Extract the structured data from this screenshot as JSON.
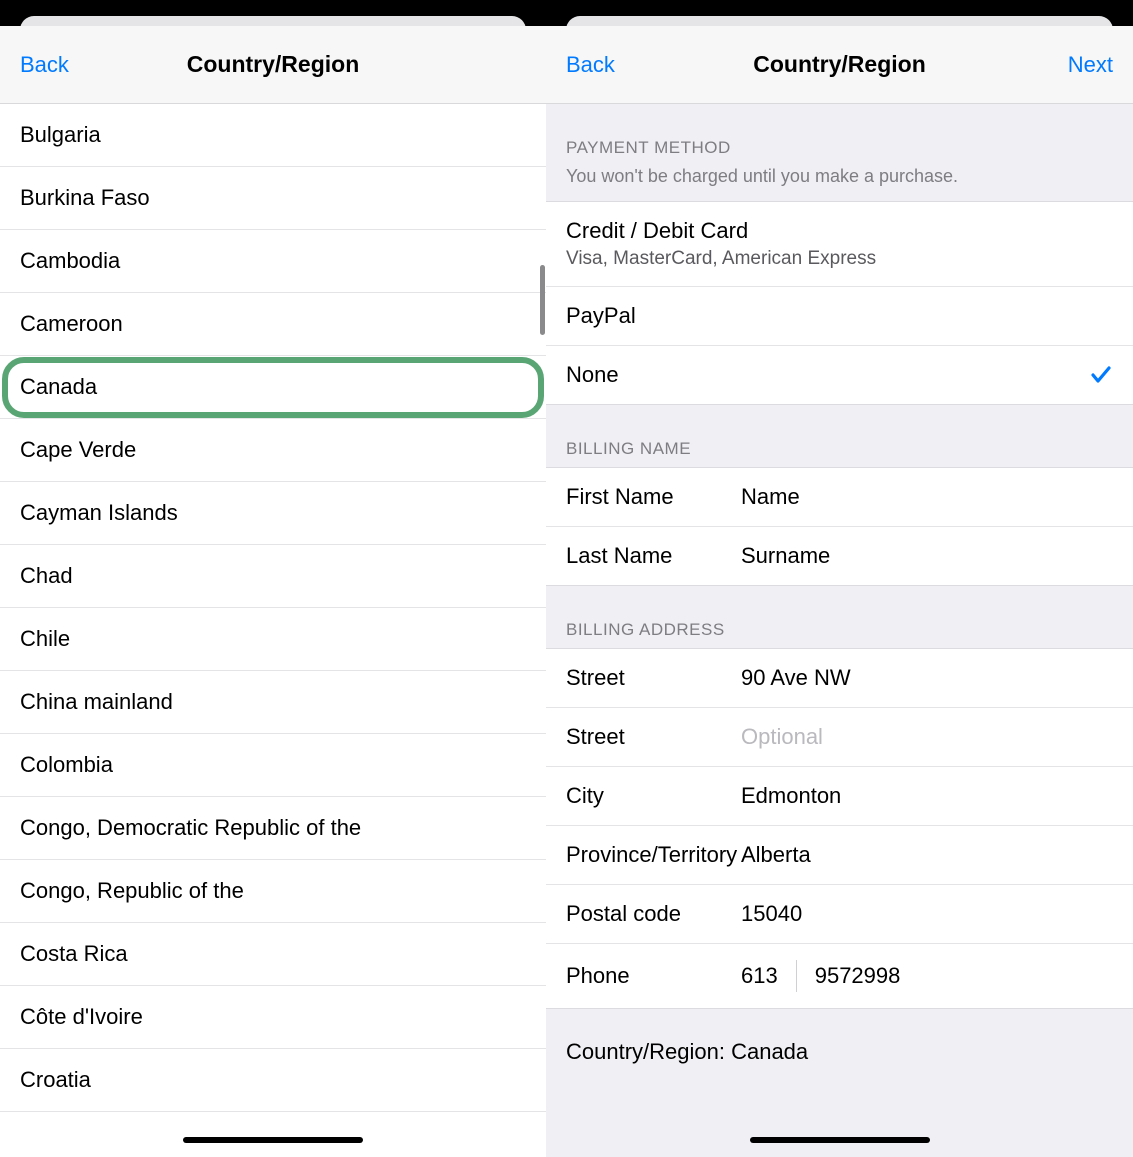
{
  "left": {
    "nav": {
      "back": "Back",
      "title": "Country/Region"
    },
    "countries": [
      "Bulgaria",
      "Burkina Faso",
      "Cambodia",
      "Cameroon",
      "Canada",
      "Cape Verde",
      "Cayman Islands",
      "Chad",
      "Chile",
      "China mainland",
      "Colombia",
      "Congo, Democratic Republic of the",
      "Congo, Republic of the",
      "Costa Rica",
      "Côte d'Ivoire",
      "Croatia"
    ],
    "highlighted_index": 4
  },
  "right": {
    "nav": {
      "back": "Back",
      "title": "Country/Region",
      "next": "Next"
    },
    "payment": {
      "header": "PAYMENT METHOD",
      "sub": "You won't be charged until you make a purchase.",
      "options": [
        {
          "label": "Credit / Debit Card",
          "sub": "Visa, MasterCard, American Express",
          "selected": false
        },
        {
          "label": "PayPal",
          "sub": "",
          "selected": false
        },
        {
          "label": "None",
          "sub": "",
          "selected": true
        }
      ]
    },
    "billing_name": {
      "header": "BILLING NAME",
      "first_label": "First Name",
      "first_value": "Name",
      "last_label": "Last Name",
      "last_value": "Surname"
    },
    "billing_address": {
      "header": "BILLING ADDRESS",
      "street1_label": "Street",
      "street1_value": "90 Ave NW",
      "street2_label": "Street",
      "street2_placeholder": "Optional",
      "city_label": "City",
      "city_value": "Edmonton",
      "province_label": "Province/Territory",
      "province_value": "Alberta",
      "postal_label": "Postal code",
      "postal_value": "15040",
      "phone_label": "Phone",
      "phone_area": "613",
      "phone_number": "9572998"
    },
    "footer": "Country/Region: Canada"
  }
}
